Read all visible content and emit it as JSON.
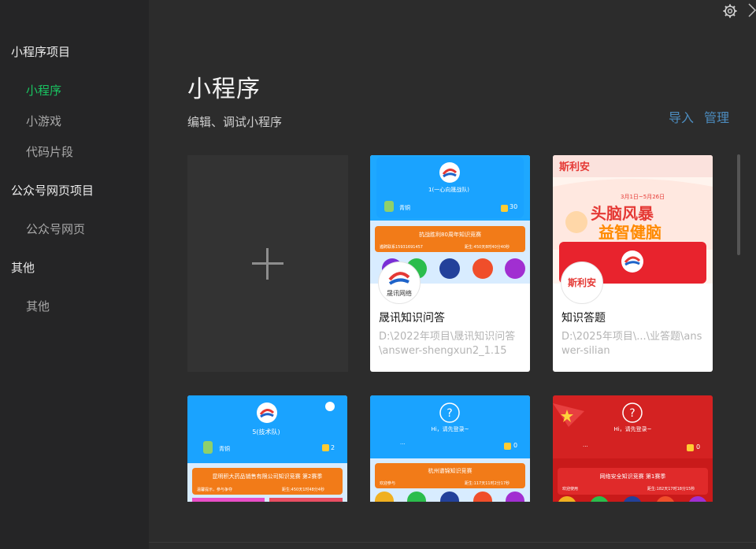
{
  "sidebar": {
    "sections": [
      {
        "title": "小程序项目",
        "items": [
          "小程序",
          "小游戏",
          "代码片段"
        ]
      },
      {
        "title": "公众号网页项目",
        "items": [
          "公众号网页"
        ]
      },
      {
        "title": "其他",
        "items": [
          "其他"
        ]
      }
    ],
    "active": "小程序"
  },
  "main": {
    "title": "小程序",
    "subtitle": "编辑、调试小程序",
    "actions": [
      "导入",
      "管理"
    ]
  },
  "cards": [
    {
      "name": "晟讯知识问答",
      "path": "D:\\2022年项目\\晟讯知识问答\\answer-shengxun2_1.15",
      "thumb": {
        "team": "1(一心向晟战队)",
        "rank": "青铜",
        "coins": "30",
        "banner": "抗战胜利80周年知识竞赛",
        "footer_left": "遴聘联系15931691457",
        "footer_right": "距生:450天8时40分40秒"
      },
      "avatar_text": "晟讯网络"
    },
    {
      "name": "知识答题",
      "path": "D:\\2025年项目\\...\\业答题\\answer-silian",
      "thumb": {
        "brand": "斯利安",
        "date": "3月1日~5月26日",
        "headline1": "头脑风暴",
        "headline2": "益智健脑"
      },
      "avatar_text": "斯利安"
    }
  ],
  "cards_row2": [
    {
      "team": "5(技术队)",
      "rank": "青铜",
      "coins": "2",
      "banner": "昆明积大药品销售有限公司知识竞赛 第2赛季",
      "footer_left": "温馨提示，参与争夺",
      "footer_right": "距生:450天1时48分4秒"
    },
    {
      "greeting": "Hi，请先登录~",
      "dots": "...",
      "coins": "0",
      "banner": "杭州谱锦知识竞赛",
      "footer_left": "欢迎参与",
      "footer_right": "距生:117天11时2分17秒"
    },
    {
      "greeting": "Hi，请先登录~",
      "dots": "...",
      "coins": "0",
      "banner": "网络安全知识竞赛 第1赛季",
      "footer_left": "欢迎使用",
      "footer_right": "距生:182天17时18分15秒"
    }
  ]
}
